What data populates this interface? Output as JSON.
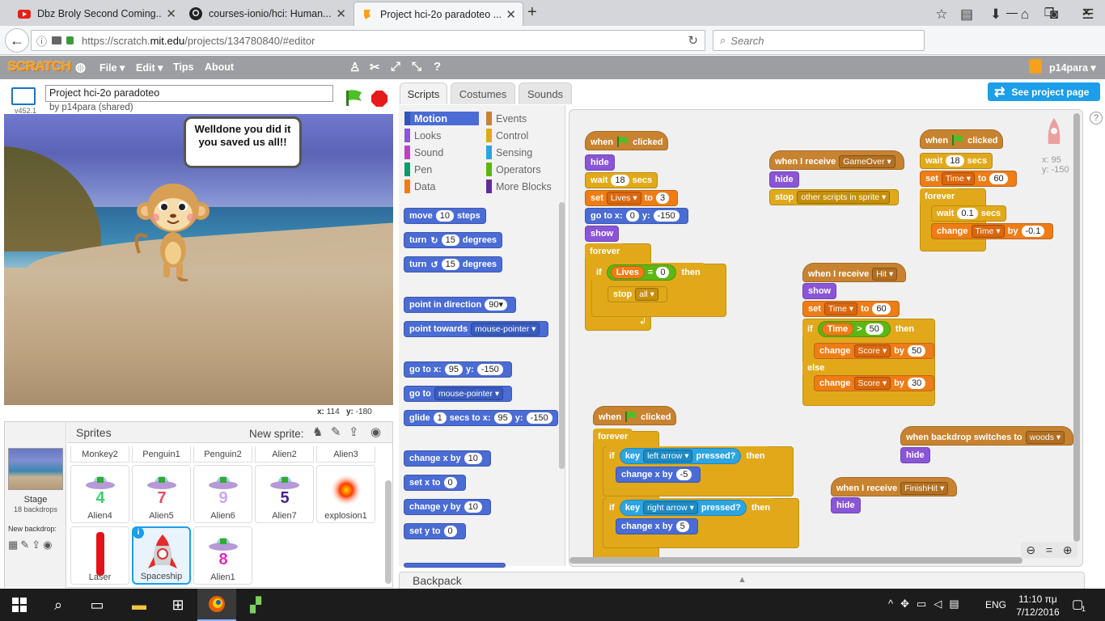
{
  "browser": {
    "tabs": [
      {
        "title": "Dbz Broly Second Coming...",
        "icon": "youtube-icon"
      },
      {
        "title": "courses-ionio/hci: Human...",
        "icon": "github-icon"
      },
      {
        "title": "Project hci-2o paradoteo ...",
        "icon": "scratch-icon"
      }
    ],
    "new_tab": "+",
    "url_prefix": "https://scratch.",
    "url_domain": "mit.edu",
    "url_rest": "/projects/134780840/#editor",
    "search_placeholder": "Search"
  },
  "scratch": {
    "logo": "SCRATCH",
    "menu": [
      "File ▾",
      "Edit ▾",
      "Tips",
      "About"
    ],
    "user": "p14para ▾",
    "version": "v452.1",
    "project_title": "Project hci-2o paradoteo",
    "byline": "by p14para (shared)",
    "speech": "Welldone you did it you saved us all!!",
    "coords": {
      "x_label": "x:",
      "x": "114",
      "y_label": "y:",
      "y": "-180"
    },
    "tabs": [
      "Scripts",
      "Costumes",
      "Sounds"
    ],
    "see_project": "See project page",
    "categories_left": [
      "Motion",
      "Looks",
      "Sound",
      "Pen",
      "Data"
    ],
    "categories_right": [
      "Events",
      "Control",
      "Sensing",
      "Operators",
      "More Blocks"
    ],
    "category_colors": {
      "Motion": "#4a6cd4",
      "Looks": "#8a55d7",
      "Sound": "#bb42c3",
      "Pen": "#0e9a6c",
      "Data": "#ee7d16",
      "Events": "#c88330",
      "Control": "#e1a91a",
      "Sensing": "#2ca5e2",
      "Operators": "#5cb712",
      "More Blocks": "#632d99"
    },
    "palette": {
      "move": [
        "move",
        "10",
        "steps"
      ],
      "turn_r": [
        "turn",
        "15",
        "degrees"
      ],
      "turn_l": [
        "turn",
        "15",
        "degrees"
      ],
      "point_dir": [
        "point in direction",
        "90▾"
      ],
      "point_towards": [
        "point towards",
        "mouse-pointer ▾"
      ],
      "goto_xy": [
        "go to x:",
        "95",
        "y:",
        "-150"
      ],
      "goto": [
        "go to",
        "mouse-pointer ▾"
      ],
      "glide": [
        "glide",
        "1",
        "secs to x:",
        "95",
        "y:",
        "-150"
      ],
      "change_x": [
        "change x by",
        "10"
      ],
      "set_x": [
        "set x to",
        "0"
      ],
      "change_y": [
        "change y by",
        "10"
      ],
      "set_y": [
        "set y to",
        "0"
      ]
    },
    "script1": {
      "when": "when",
      "clicked": "clicked",
      "hide": "hide",
      "wait": "wait",
      "wait_val": "18",
      "secs": "secs",
      "set": "set",
      "lives": "Lives ▾",
      "to": "to",
      "lives_val": "3",
      "goto": "go to x:",
      "gx": "0",
      "y": "y:",
      "gy": "-150",
      "show": "show",
      "forever": "forever",
      "if": "if",
      "lives_rep": "Lives",
      "eq": "=",
      "zero": "0",
      "then": "then",
      "stop": "stop",
      "all": "all ▾"
    },
    "script2": {
      "when_receive": "when I receive",
      "msg": "GameOver ▾",
      "hide": "hide",
      "stop": "stop",
      "opt": "other scripts in sprite ▾"
    },
    "script3": {
      "when": "when",
      "clicked": "clicked",
      "wait": "wait",
      "wv": "18",
      "secs": "secs",
      "set": "set",
      "time": "Time ▾",
      "to": "to",
      "tv": "60",
      "forever": "forever",
      "wait2": "wait",
      "wv2": "0.1",
      "secs2": "secs",
      "change": "change",
      "time2": "Time ▾",
      "by": "by",
      "cv": "-0.1"
    },
    "script4": {
      "when_receive": "when I receive",
      "msg": "Hit ▾",
      "show": "show",
      "set": "set",
      "time": "Time ▾",
      "to": "to",
      "tv": "60",
      "if": "if",
      "time_rep": "Time",
      "gt": ">",
      "gv": "50",
      "then": "then",
      "change": "change",
      "score": "Score ▾",
      "by": "by",
      "v1": "50",
      "else": "else",
      "change2": "change",
      "score2": "Score ▾",
      "by2": "by",
      "v2": "30"
    },
    "script5": {
      "when": "when",
      "clicked": "clicked",
      "forever": "forever",
      "if": "if",
      "key": "key",
      "k1": "left arrow ▾",
      "pressed": "pressed?",
      "then": "then",
      "change_x": "change x by",
      "v1": "-5",
      "if2": "if",
      "key2": "key",
      "k2": "right arrow ▾",
      "pressed2": "pressed?",
      "then2": "then",
      "change_x2": "change x by",
      "v2": "5"
    },
    "script6": {
      "when_backdrop": "when backdrop switches to",
      "bd": "woods ▾",
      "hide": "hide"
    },
    "script7": {
      "when_receive": "when I receive",
      "msg": "FinishHit ▾",
      "hide": "hide"
    },
    "sprite_info": {
      "x": "x: 95",
      "y": "y: -150"
    },
    "sprites_title": "Sprites",
    "new_sprite": "New sprite:",
    "stage_label": "Stage",
    "backdrops": "18 backdrops",
    "new_backdrop": "New backdrop:",
    "sprite_row_top": [
      "Monkey2",
      "Penguin1",
      "Penguin2",
      "Alien2",
      "Alien3"
    ],
    "sprites_row1": [
      {
        "name": "Alien4",
        "num": "4",
        "color": "#3bd16f"
      },
      {
        "name": "Alien5",
        "num": "7",
        "color": "#e44c6a"
      },
      {
        "name": "Alien6",
        "num": "9",
        "color": "#c9a7f0"
      },
      {
        "name": "Alien7",
        "num": "5",
        "color": "#4a1f8c"
      },
      {
        "name": "explosion1"
      }
    ],
    "sprites_row2": [
      {
        "name": "Laser"
      },
      {
        "name": "Spaceship"
      },
      {
        "name": "Alien1",
        "num": "8",
        "color": "#e22cb4"
      }
    ],
    "backpack": "Backpack"
  },
  "taskbar": {
    "lang": "ENG",
    "time": "11:10 πμ",
    "date": "7/12/2016",
    "notif": "1"
  }
}
